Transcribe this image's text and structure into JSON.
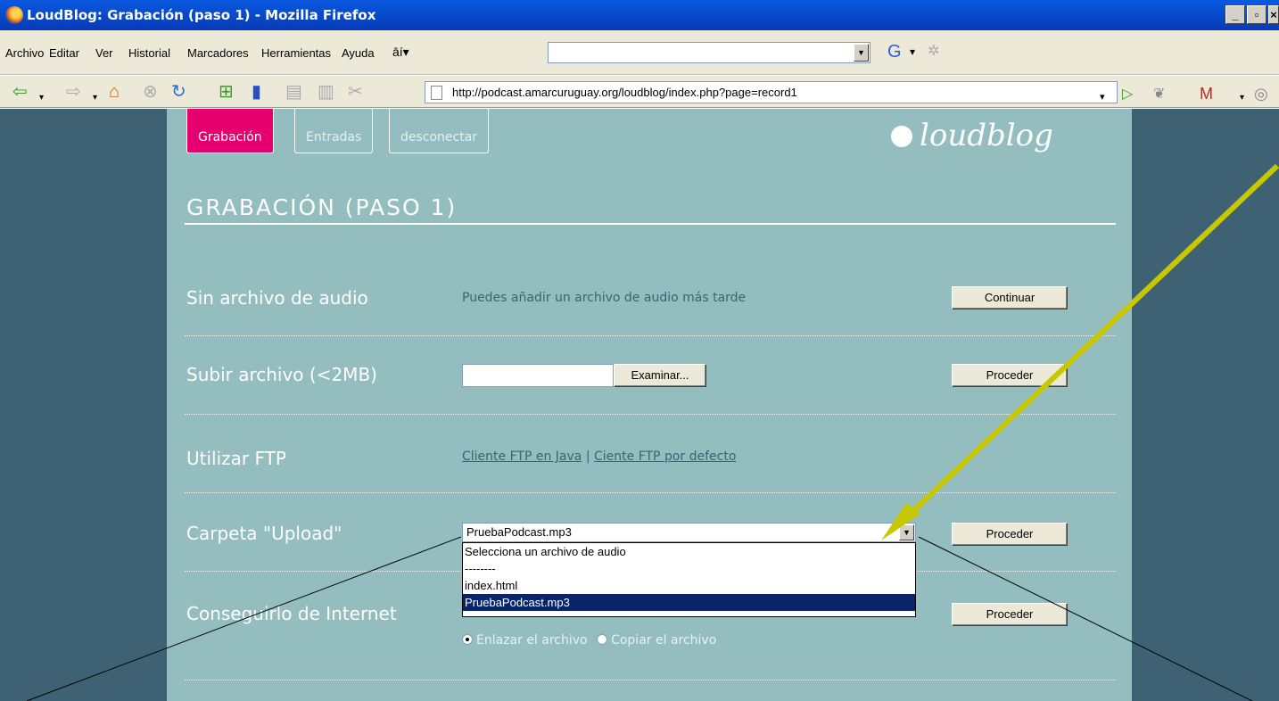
{
  "window": {
    "title": "LoudBlog: Grabación (paso 1) - Mozilla Firefox"
  },
  "menubar": {
    "items": [
      "Archivo",
      "Editar",
      "Ver",
      "Historial",
      "Marcadores",
      "Herramientas",
      "Ayuda"
    ]
  },
  "navbar": {
    "url": "http://podcast.amarcuruguay.org/loudblog/index.php?page=record1"
  },
  "tabs": {
    "grabacion": "Grabación",
    "entradas": "Entradas",
    "desconectar": "desconectar"
  },
  "logo": {
    "text": "loudblog"
  },
  "heading": "GRABACIÓN (PASO 1)",
  "rows": {
    "sin_audio": {
      "label": "Sin archivo de audio",
      "text": "Puedes añadir un archivo de audio más tarde",
      "button": "Continuar"
    },
    "subir": {
      "label": "Subir archivo (<2MB)",
      "browse": "Examinar...",
      "button": "Proceder"
    },
    "ftp": {
      "label": "Utilizar FTP",
      "link1": "Cliente FTP en Java",
      "divider": "|",
      "link2": "Ciente FTP por defecto"
    },
    "upload": {
      "label": "Carpeta \"Upload\"",
      "selected": "PruebaPodcast.mp3",
      "options": [
        "Selecciona un archivo de audio",
        "--------",
        "index.html",
        "PruebaPodcast.mp3"
      ],
      "button": "Proceder"
    },
    "internet": {
      "label": "Conseguirlo de Internet",
      "button": "Proceder",
      "radio1": "Enlazar el archivo",
      "radio2": "Copiar el archivo"
    }
  },
  "colors": {
    "accent": "#e6006f",
    "page_bg": "#3e6273",
    "content_bg": "#94bdc0",
    "annotation_arrow": "#c8c800"
  }
}
